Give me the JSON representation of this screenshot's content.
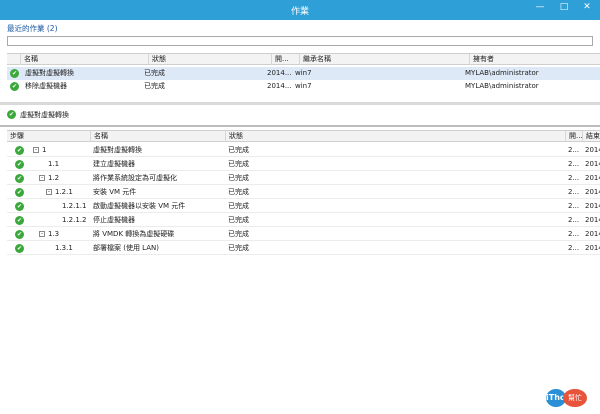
{
  "window": {
    "title": "作業",
    "min": "—",
    "max": "□",
    "close": "✕"
  },
  "recent": {
    "label": "最近的作業 (2)",
    "columns": [
      "名稱",
      "狀態",
      "開...",
      "繼承名稱",
      "擁有者"
    ],
    "rows": [
      {
        "name": "虛擬對虛擬轉換",
        "status": "已完成",
        "start": "2014...",
        "target": "win7",
        "owner": "MYLAB\\administrator"
      },
      {
        "name": "移除虛擬機器",
        "status": "已完成",
        "start": "2014...",
        "target": "win7",
        "owner": "MYLAB\\administrator"
      }
    ]
  },
  "detail": {
    "title": "虛擬對虛擬轉換",
    "columns": [
      "步驟",
      "名稱",
      "狀態",
      "開...",
      "結束"
    ],
    "steps": [
      {
        "step": "1",
        "name": "虛擬對虛擬轉換",
        "status": "已完成",
        "start": "2...",
        "end": "2014"
      },
      {
        "step": "1.1",
        "name": "建立虛擬機器",
        "status": "已完成",
        "start": "2...",
        "end": "2014"
      },
      {
        "step": "1.2",
        "name": "將作業系統設定為可虛擬化",
        "status": "已完成",
        "start": "2...",
        "end": "2014"
      },
      {
        "step": "1.2.1",
        "name": "安裝 VM 元件",
        "status": "已完成",
        "start": "2...",
        "end": "2014"
      },
      {
        "step": "1.2.1.1",
        "name": "啟動虛擬機器以安裝 VM 元件",
        "status": "已完成",
        "start": "2...",
        "end": "2014"
      },
      {
        "step": "1.2.1.2",
        "name": "停止虛擬機器",
        "status": "已完成",
        "start": "2...",
        "end": "2014"
      },
      {
        "step": "1.3",
        "name": "將 VMDK 轉換為虛擬硬碟",
        "status": "已完成",
        "start": "2...",
        "end": "2014"
      },
      {
        "step": "1.3.1",
        "name": "部署檔案 (使用 LAN)",
        "status": "已完成",
        "start": "2...",
        "end": "2014"
      }
    ]
  },
  "icons": {
    "status": "check-circle-icon",
    "expander": "collapse-icon"
  },
  "colors": {
    "titlebar": "#2f9fd8",
    "success": "#3aa83a",
    "selected": "#dde9f7"
  },
  "watermark": {
    "logo": "iThome",
    "text": "幫忙"
  }
}
